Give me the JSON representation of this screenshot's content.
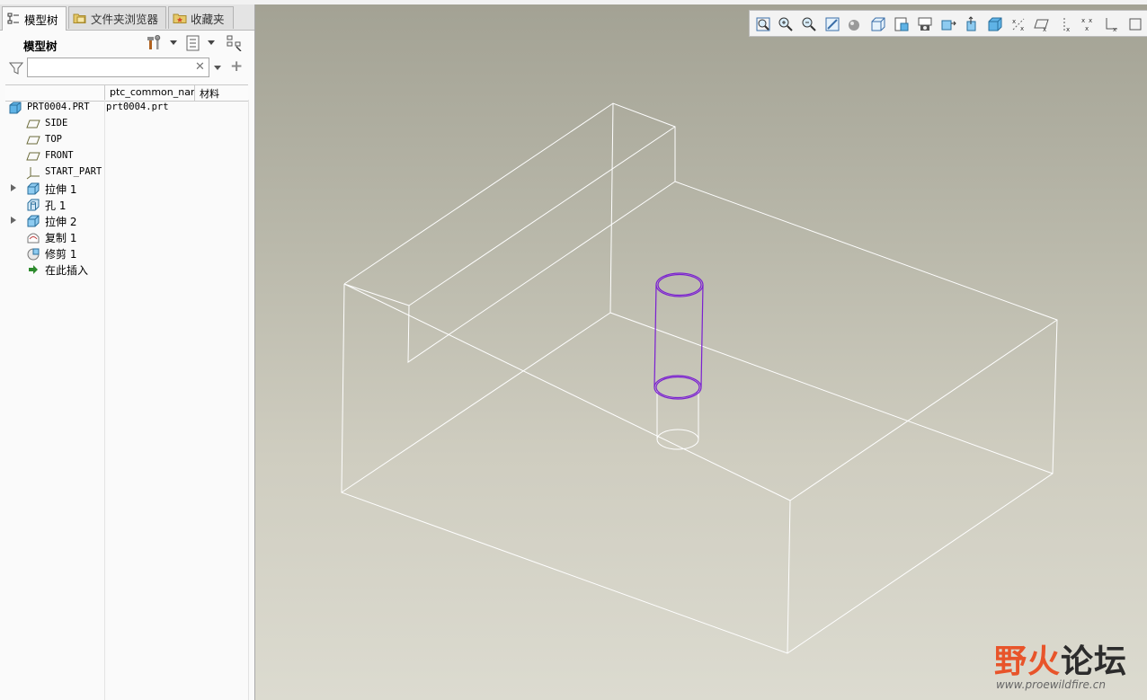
{
  "tabs": [
    {
      "label": "模型树",
      "icon": "model-tree-icon",
      "active": true
    },
    {
      "label": "文件夹浏览器",
      "icon": "folder-browser-icon",
      "active": false
    },
    {
      "label": "收藏夹",
      "icon": "favorites-icon",
      "active": false
    }
  ],
  "tree_panel": {
    "title": "模型树",
    "search": {
      "value": "",
      "placeholder": ""
    },
    "columns": [
      "ptc_common_name",
      "材料"
    ],
    "items": [
      {
        "label": "PRT0004.PRT",
        "icon": "part-icon",
        "common_name": "prt0004.prt",
        "expandable": false
      },
      {
        "label": "SIDE",
        "icon": "datum-plane-icon",
        "expandable": false
      },
      {
        "label": "TOP",
        "icon": "datum-plane-icon",
        "expandable": false
      },
      {
        "label": "FRONT",
        "icon": "datum-plane-icon",
        "expandable": false
      },
      {
        "label": "START_PART",
        "icon": "coordinate-system-icon",
        "expandable": false
      },
      {
        "label": "拉伸 1",
        "icon": "extrude-icon",
        "expandable": true
      },
      {
        "label": "孔 1",
        "icon": "hole-icon",
        "expandable": false
      },
      {
        "label": "拉伸 2",
        "icon": "extrude-icon",
        "expandable": true
      },
      {
        "label": "复制 1",
        "icon": "copy-icon",
        "expandable": false
      },
      {
        "label": "修剪 1",
        "icon": "trim-icon",
        "expandable": false
      },
      {
        "label": "在此插入",
        "icon": "insert-here-icon",
        "expandable": false
      }
    ]
  },
  "view_toolbar": [
    "refit-icon",
    "zoom-in-icon",
    "zoom-out-icon",
    "repaint-icon",
    "display-style-icon",
    "saved-orientations-icon",
    "view-manager-icon",
    "perspective-view-icon",
    "plane-display-icon",
    "axis-display-icon",
    "point-display-icon",
    "csys-display-icon",
    "annotation-display-icon",
    "spin-center-icon",
    "datum-display-filter-icon",
    "model-display-icon",
    "more-icon"
  ],
  "colors": {
    "wireframe": "#ffffff",
    "highlight": "#7a1fd1",
    "viewport_top": "#a3a294",
    "viewport_bottom": "#dcdbd0"
  },
  "watermark": {
    "main_a": "野火",
    "main_b": "论坛",
    "sub": "www.proewildfire.cn"
  }
}
